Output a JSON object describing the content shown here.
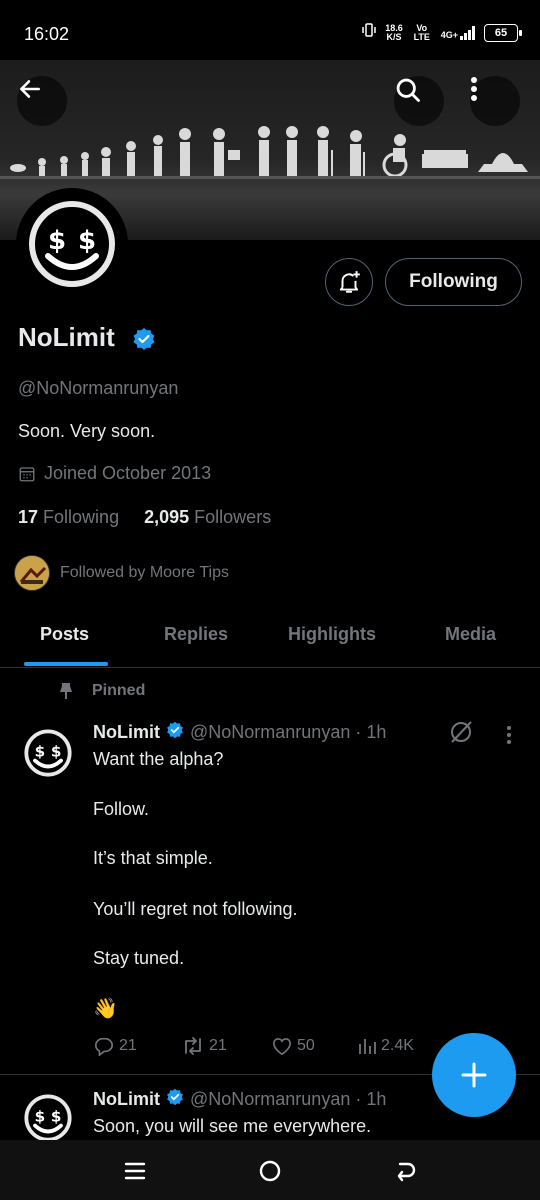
{
  "status": {
    "time": "16:02",
    "speed_value": "18.6",
    "speed_unit": "K/S",
    "network": "Vo LTE",
    "signal": "4G+",
    "battery": "65"
  },
  "profile": {
    "name": "NoLimit",
    "handle": "@NoNormanrunyan",
    "bio": "Soon. Very soon.",
    "joined": "Joined October 2013",
    "following_count": "17",
    "following_label": "Following",
    "followers_count": "2,095",
    "followers_label": "Followers",
    "followed_by": "Followed by Moore Tips",
    "follow_button": "Following"
  },
  "tabs": [
    "Posts",
    "Replies",
    "Highlights",
    "Media"
  ],
  "pinned_label": "Pinned",
  "posts": [
    {
      "name": "NoLimit",
      "meta": "@NoNormanrunyan · 1h",
      "lines": [
        "Want the alpha?",
        "Follow.",
        "It’s that simple.",
        "You’ll regret not following.",
        "Stay tuned.",
        "👋"
      ],
      "replies": "21",
      "reposts": "21",
      "likes": "50",
      "views": "2.4K"
    },
    {
      "name": "NoLimit",
      "meta": "@NoNormanrunyan · 1h",
      "lines": [
        "Soon, you will see me everywhere."
      ]
    }
  ],
  "colors": {
    "accent": "#1d9bf0",
    "muted": "#71767b",
    "text": "#e7e9ea",
    "background": "#000000"
  }
}
